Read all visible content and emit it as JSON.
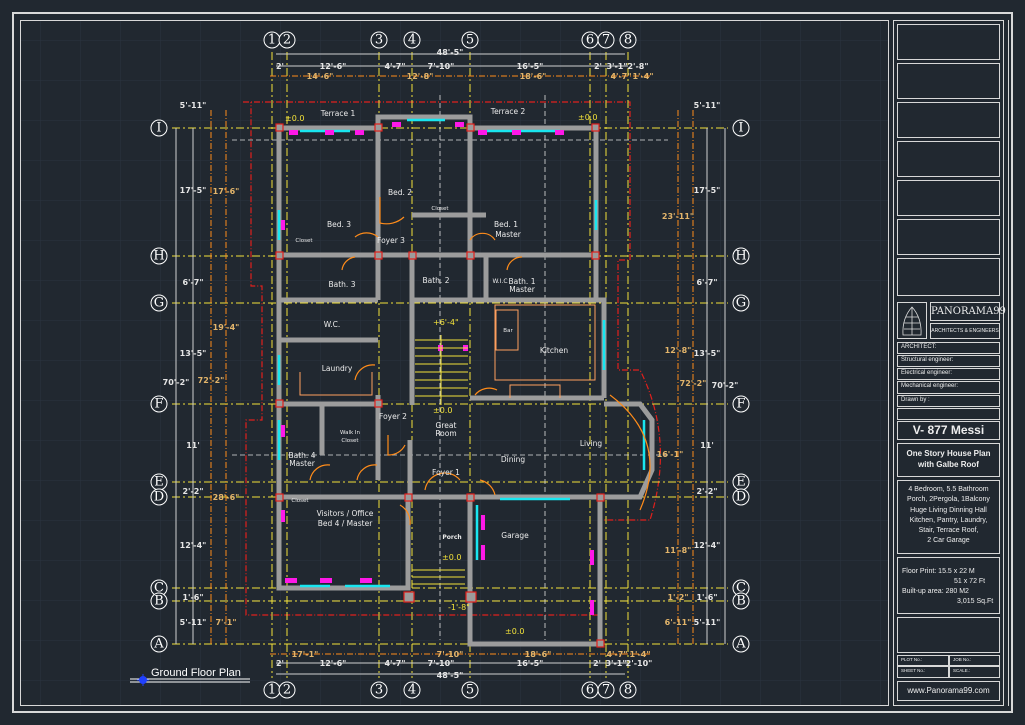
{
  "drawing": {
    "plan_title": "Ground Floor Plan",
    "grid_columns": [
      "1",
      "2",
      "3",
      "4",
      "5",
      "6",
      "7",
      "8"
    ],
    "grid_rows": [
      "I",
      "H",
      "G",
      "F",
      "E",
      "D",
      "C",
      "B",
      "A"
    ],
    "top_dims": {
      "overall": "48'-5\"",
      "row": [
        "2'",
        "12'-6\"",
        "4'-7\"",
        "7'-10\"",
        "16'-5\"",
        "2'",
        "3'-1\"",
        "2'-8\""
      ],
      "orange": [
        "14'-6\"",
        "12'-8\"",
        "18'-6\"",
        "4'-7\"",
        "1'-4\""
      ]
    },
    "bottom_dims": {
      "overall": "48'-5\"",
      "row": [
        "2'",
        "12'-6\"",
        "4'-7\"",
        "7'-10\"",
        "16'-5\"",
        "2'",
        "3'-1\"",
        "2'-10\""
      ],
      "orange": [
        "17'-1\"",
        "7'-10\"",
        "18'-6\"",
        "4'-7\"",
        "1'-4\""
      ]
    },
    "left_dims": {
      "overall": "70'-2\"",
      "row": [
        "5'-11\"",
        "17'-5\"",
        "6'-7\"",
        "13'-5\"",
        "11'",
        "2'-2\"",
        "12'-4\"",
        "1'-6\"",
        "5'-11\""
      ],
      "orange": [
        "17'-6\"",
        "19'-4\"",
        "72'-2\"",
        "28'-6\"",
        "7'-1\""
      ]
    },
    "right_dims": {
      "overall": "70'-2\"",
      "row": [
        "5'-11\"",
        "17'-5\"",
        "6'-7\"",
        "13'-5\"",
        "11'",
        "2'-2\"",
        "12'-4\"",
        "1'-6\"",
        "5'-11\""
      ],
      "orange": [
        "23'-11\"",
        "12'-8\"",
        "72'-2\"",
        "16'-1\"",
        "11'-8\"",
        "1'-2\"",
        "6'-11\""
      ]
    },
    "rooms": {
      "terrace1": "Terrace 1",
      "terrace2": "Terrace 2",
      "bed2": "Bed. 2",
      "closet_bed2": "Closet",
      "bed3": "Bed. 3",
      "bed1_a": "Bed. 1",
      "bed1_b": "Master",
      "foyer3": "Foyer 3",
      "closet_bed3": "Closet",
      "bath3": "Bath. 3",
      "bath2": "Bath. 2",
      "wic": "W.I.C",
      "bath1_a": "Bath. 1",
      "bath1_b": "Master",
      "wc": "W.C.",
      "laundry": "Laundry",
      "bar": "Bar",
      "kitchen": "Kitchen",
      "foyer2": "Foyer 2",
      "great_a": "Great",
      "great_b": "Room",
      "walkin_a": "Walk In",
      "walkin_b": "Closet",
      "bath4_a": "Bath. 4",
      "bath4_b": "Master",
      "living": "Living",
      "dining": "Dining",
      "foyer1": "Foyer 1",
      "closet_bed4": "Closet",
      "visitors_a": "Visitors / Office",
      "visitors_b": "Bed 4 / Master",
      "porch": "Porch",
      "garage": "Garage"
    },
    "levels": [
      "±0.0",
      "±0.0",
      "+6'-4\"",
      "±0.0",
      "±0.0",
      "-1'-8\"",
      "±0.0"
    ]
  },
  "title_block": {
    "company": "PANORAMA99",
    "company_sub": "ARCHITECTS & ENGINEERS",
    "fields": [
      "ARCHITECT:",
      "Structural engineer:",
      "Electrical engineer:",
      "Mechanical engineer:",
      "Drawn by :"
    ],
    "plan_code": "V- 877 Messi",
    "subtitle": [
      "One Story House Plan",
      "with Galbe Roof"
    ],
    "description": [
      "4 Bedroom, 5.5 Bathroom",
      "Porch, 2Pergola, 1Balcony",
      "Huge Living Dinning Hall",
      "Kitchen, Pantry, Laundry,",
      "Stair, Terrace Roof,",
      "2 Car Garage"
    ],
    "floor_print_label": "Floor Print: 15.5 x 22 M",
    "floor_print_ft": "51 x 72 Ft",
    "builtup_label": "Built-up area: 280 M2",
    "builtup_ft": "3,015 Sq.Ft",
    "plot_no": "PLOT No.:",
    "job_no": "JOB No.:",
    "sheet_no": "SHEET No.:",
    "scale": "SCALE.:",
    "website": "www.Panorama99.com"
  },
  "colors": {
    "background": "#212830",
    "axis": "#f3e23a",
    "wall": "#9c9c9c",
    "roof": "#e0201c",
    "door": "#ff8c1a",
    "window": "#19e6f0",
    "dim": "#e6e6e6",
    "dim_orange": "#e3b56b"
  }
}
